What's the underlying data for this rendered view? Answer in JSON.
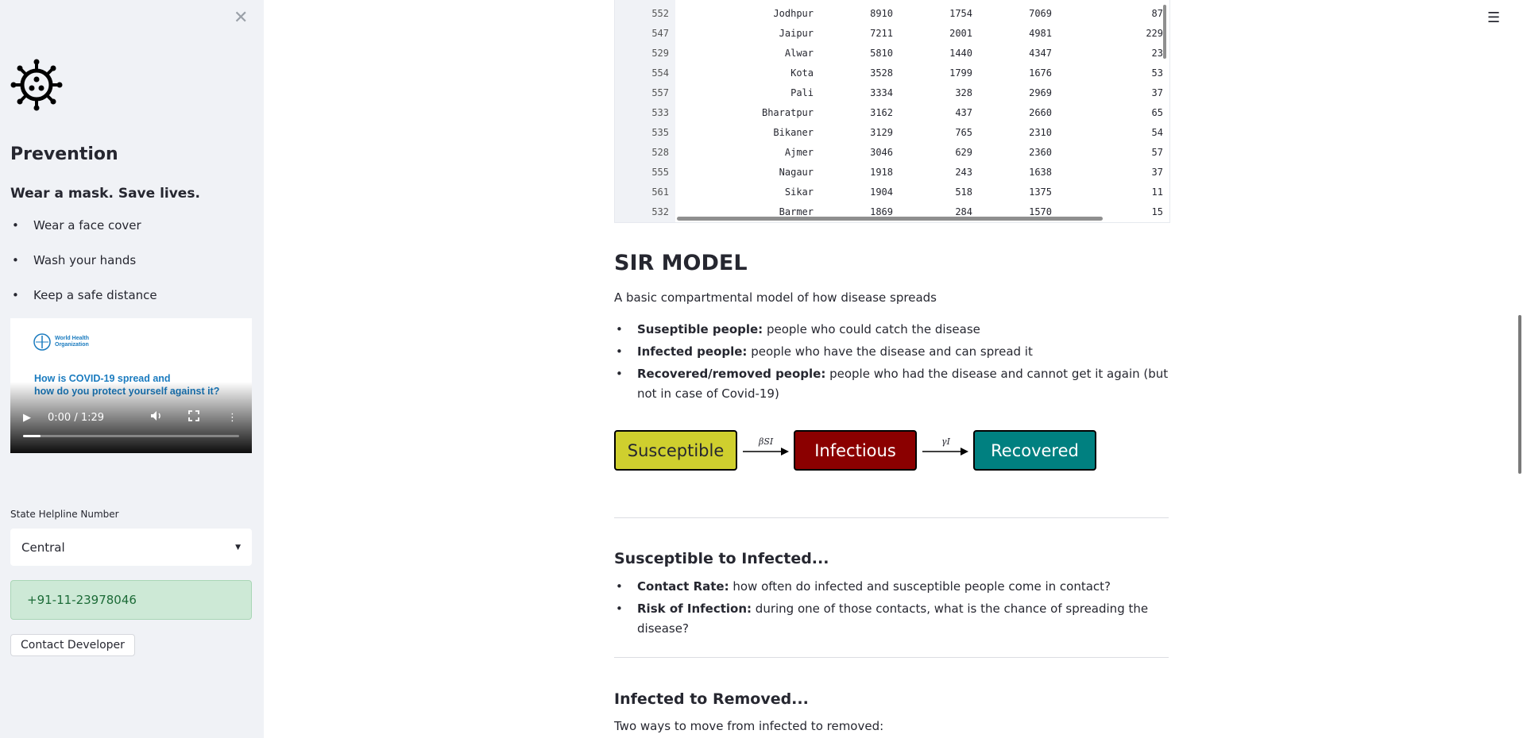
{
  "sidebar": {
    "title": "Prevention",
    "subtitle": "Wear a mask. Save lives.",
    "items": [
      "Wear a face cover",
      "Wash your hands",
      "Keep a safe distance"
    ],
    "video": {
      "org_line1": "World Health",
      "org_line2": "Organization",
      "caption": "How is COVID-19 spread and\nhow do you protect yourself against it?",
      "time": "0:00 / 1:29",
      "progress": 0.08
    },
    "helpline_label": "State Helpline Number",
    "helpline_select": "Central",
    "helpline_number": "+91-11-23978046",
    "contact_button": "Contact Developer"
  },
  "table": {
    "rows": [
      {
        "index": "552",
        "district": "Jodhpur",
        "a": "8910",
        "b": "1754",
        "c": "7069",
        "d": "87"
      },
      {
        "index": "547",
        "district": "Jaipur",
        "a": "7211",
        "b": "2001",
        "c": "4981",
        "d": "229"
      },
      {
        "index": "529",
        "district": "Alwar",
        "a": "5810",
        "b": "1440",
        "c": "4347",
        "d": "23"
      },
      {
        "index": "554",
        "district": "Kota",
        "a": "3528",
        "b": "1799",
        "c": "1676",
        "d": "53"
      },
      {
        "index": "557",
        "district": "Pali",
        "a": "3334",
        "b": "328",
        "c": "2969",
        "d": "37"
      },
      {
        "index": "533",
        "district": "Bharatpur",
        "a": "3162",
        "b": "437",
        "c": "2660",
        "d": "65"
      },
      {
        "index": "535",
        "district": "Bikaner",
        "a": "3129",
        "b": "765",
        "c": "2310",
        "d": "54"
      },
      {
        "index": "528",
        "district": "Ajmer",
        "a": "3046",
        "b": "629",
        "c": "2360",
        "d": "57"
      },
      {
        "index": "555",
        "district": "Nagaur",
        "a": "1918",
        "b": "243",
        "c": "1638",
        "d": "37"
      },
      {
        "index": "561",
        "district": "Sikar",
        "a": "1904",
        "b": "518",
        "c": "1375",
        "d": "11"
      },
      {
        "index": "532",
        "district": "Barmer",
        "a": "1869",
        "b": "284",
        "c": "1570",
        "d": "15"
      }
    ]
  },
  "sir": {
    "heading": "SIR MODEL",
    "intro": "A basic compartmental model of how disease spreads",
    "bullets": [
      {
        "bold": "Suseptible people:",
        "text": " people who could catch the disease"
      },
      {
        "bold": "Infected people:",
        "text": " people who have the disease and can spread it"
      },
      {
        "bold": "Recovered/removed people:",
        "text": " people who had the disease and cannot get it again (but not in case of Covid-19)"
      }
    ],
    "diagram": {
      "box1": "Susceptible",
      "box1_color": "#cfcf2e",
      "rate1": "βSI",
      "box2": "Infectious",
      "box2_color": "#8b0000",
      "rate2": "γI",
      "box3": "Recovered",
      "box3_color": "#008080"
    }
  },
  "s_to_i": {
    "heading": "Susceptible to Infected...",
    "bullets": [
      {
        "bold": "Contact Rate:",
        "text": " how often do infected and susceptible people come in contact?"
      },
      {
        "bold": "Risk of Infection:",
        "text": " during one of those contacts, what is the chance of spreading the disease?"
      }
    ]
  },
  "i_to_r": {
    "heading": "Infected to Removed...",
    "intro": "Two ways to move from infected to removed:"
  },
  "icons": {
    "close": "close-icon",
    "menu": "hamburger-menu-icon",
    "logo": "virus-icon"
  }
}
